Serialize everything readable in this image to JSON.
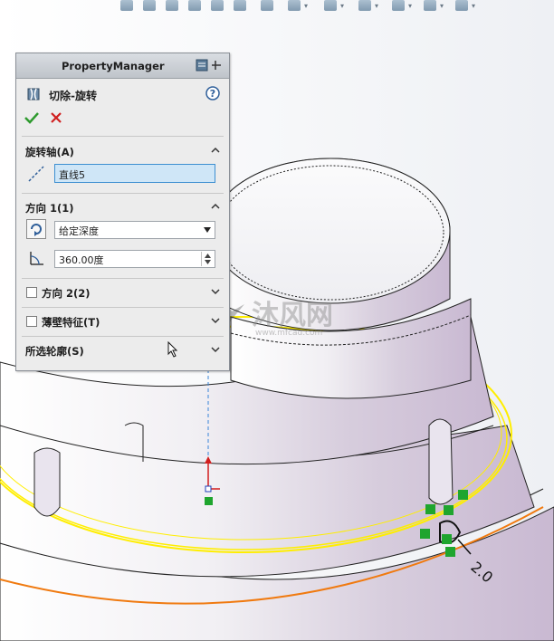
{
  "pm": {
    "title": "PropertyManager",
    "feature_name": "切除-旋转",
    "help_icon": "help-icon",
    "ok_icon": "checkmark-icon",
    "cancel_icon": "x-icon",
    "axis_section": {
      "label": "旋转轴(A)",
      "value": "直线5"
    },
    "dir1_section": {
      "label": "方向 1(1)",
      "end_condition": "给定深度",
      "angle": "360.00度"
    },
    "dir2_section": {
      "label": "方向 2(2)"
    },
    "thin_section": {
      "label": "薄壁特征(T)"
    },
    "contours_section": {
      "label": "所选轮廓(S)"
    }
  },
  "viewport": {
    "dimension": "2.0",
    "watermark_text": "沐风网",
    "watermark_url": "www.mfcad.com"
  },
  "colors": {
    "model": "#e6e3ea",
    "model_shade": "#cfc4d6",
    "edge_highlight": "#ffee00",
    "orange_edge": "#f07a10",
    "relation_green": "#1fa52e",
    "axis_blue": "#3a86d8",
    "pm_background": "#ececec"
  }
}
